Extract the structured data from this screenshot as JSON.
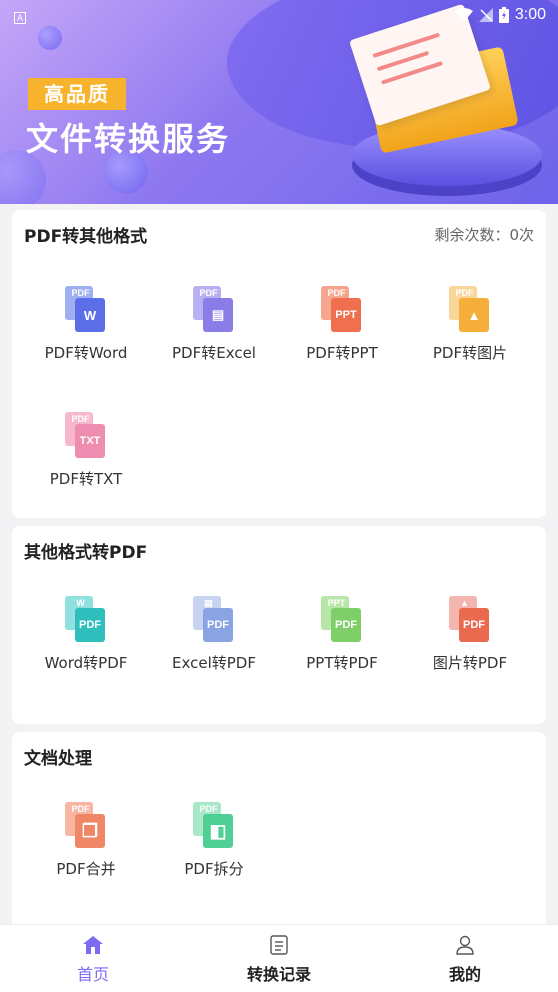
{
  "status_bar": {
    "app_badge": "A",
    "time": "3:00"
  },
  "banner": {
    "tag": "高品质",
    "headline": "文件转换服务"
  },
  "section_pdf_to_other": {
    "title": "PDF转其他格式",
    "remaining": "剩余次数：0次",
    "tools": [
      {
        "label": "PDF转Word",
        "back_text": "PDF",
        "front_text": "W",
        "back_color": "#9fb0f0",
        "front_color": "#5b6ee8"
      },
      {
        "label": "PDF转Excel",
        "back_text": "PDF",
        "front_text": "▤",
        "back_color": "#b8b0f0",
        "front_color": "#8b7de8"
      },
      {
        "label": "PDF转PPT",
        "back_text": "PDF",
        "front_text": "PPT",
        "back_color": "#f6a58e",
        "front_color": "#ef6f4e"
      },
      {
        "label": "PDF转图片",
        "back_text": "PDF",
        "front_text": "▲",
        "back_color": "#fbd69a",
        "front_color": "#f5ae3a"
      },
      {
        "label": "PDF转TXT",
        "back_text": "PDF",
        "front_text": "TXT",
        "back_color": "#f7b7cf",
        "front_color": "#ef8db1"
      }
    ]
  },
  "section_other_to_pdf": {
    "title": "其他格式转PDF",
    "tools": [
      {
        "label": "Word转PDF",
        "back_text": "W",
        "front_text": "PDF",
        "back_color": "#8fe0df",
        "front_color": "#2ebfbd"
      },
      {
        "label": "Excel转PDF",
        "back_text": "▤",
        "front_text": "PDF",
        "back_color": "#c7d3f0",
        "front_color": "#8aa3e2"
      },
      {
        "label": "PPT转PDF",
        "back_text": "PPT",
        "front_text": "PDF",
        "back_color": "#b8e6a9",
        "front_color": "#7fcf68"
      },
      {
        "label": "图片转PDF",
        "back_text": "▲",
        "front_text": "PDF",
        "back_color": "#f3b5ad",
        "front_color": "#ea6a50"
      }
    ]
  },
  "section_doc_processing": {
    "title": "文档处理",
    "tools": [
      {
        "label": "PDF合并",
        "back_text": "PDF",
        "front_text": "❐",
        "back_color": "#f6b6a2",
        "front_color": "#ef8766"
      },
      {
        "label": "PDF拆分",
        "back_text": "PDF",
        "front_text": "◧",
        "back_color": "#a8e7c7",
        "front_color": "#4fcf95"
      }
    ]
  },
  "bottom_nav": {
    "items": [
      {
        "label": "首页",
        "icon": "home-icon",
        "active": true
      },
      {
        "label": "转换记录",
        "icon": "document-list-icon",
        "active": false
      },
      {
        "label": "我的",
        "icon": "user-icon",
        "active": false
      }
    ]
  },
  "colors": {
    "accent": "#7c6cf3",
    "tag_yellow": "#f7b32b",
    "background": "#f3f3f5"
  }
}
